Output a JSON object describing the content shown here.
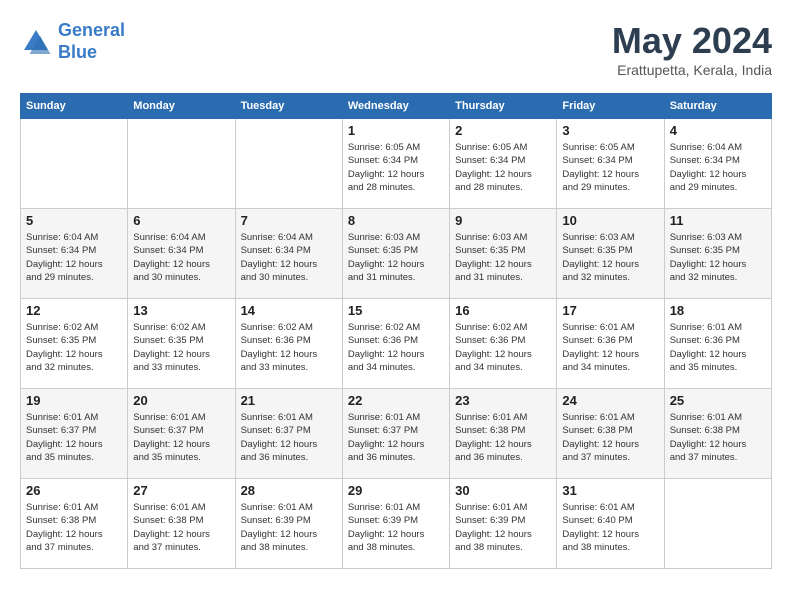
{
  "header": {
    "logo_line1": "General",
    "logo_line2": "Blue",
    "month": "May 2024",
    "location": "Erattupetta, Kerala, India"
  },
  "weekdays": [
    "Sunday",
    "Monday",
    "Tuesday",
    "Wednesday",
    "Thursday",
    "Friday",
    "Saturday"
  ],
  "weeks": [
    [
      {
        "day": "",
        "info": ""
      },
      {
        "day": "",
        "info": ""
      },
      {
        "day": "",
        "info": ""
      },
      {
        "day": "1",
        "info": "Sunrise: 6:05 AM\nSunset: 6:34 PM\nDaylight: 12 hours\nand 28 minutes."
      },
      {
        "day": "2",
        "info": "Sunrise: 6:05 AM\nSunset: 6:34 PM\nDaylight: 12 hours\nand 28 minutes."
      },
      {
        "day": "3",
        "info": "Sunrise: 6:05 AM\nSunset: 6:34 PM\nDaylight: 12 hours\nand 29 minutes."
      },
      {
        "day": "4",
        "info": "Sunrise: 6:04 AM\nSunset: 6:34 PM\nDaylight: 12 hours\nand 29 minutes."
      }
    ],
    [
      {
        "day": "5",
        "info": "Sunrise: 6:04 AM\nSunset: 6:34 PM\nDaylight: 12 hours\nand 29 minutes."
      },
      {
        "day": "6",
        "info": "Sunrise: 6:04 AM\nSunset: 6:34 PM\nDaylight: 12 hours\nand 30 minutes."
      },
      {
        "day": "7",
        "info": "Sunrise: 6:04 AM\nSunset: 6:34 PM\nDaylight: 12 hours\nand 30 minutes."
      },
      {
        "day": "8",
        "info": "Sunrise: 6:03 AM\nSunset: 6:35 PM\nDaylight: 12 hours\nand 31 minutes."
      },
      {
        "day": "9",
        "info": "Sunrise: 6:03 AM\nSunset: 6:35 PM\nDaylight: 12 hours\nand 31 minutes."
      },
      {
        "day": "10",
        "info": "Sunrise: 6:03 AM\nSunset: 6:35 PM\nDaylight: 12 hours\nand 32 minutes."
      },
      {
        "day": "11",
        "info": "Sunrise: 6:03 AM\nSunset: 6:35 PM\nDaylight: 12 hours\nand 32 minutes."
      }
    ],
    [
      {
        "day": "12",
        "info": "Sunrise: 6:02 AM\nSunset: 6:35 PM\nDaylight: 12 hours\nand 32 minutes."
      },
      {
        "day": "13",
        "info": "Sunrise: 6:02 AM\nSunset: 6:35 PM\nDaylight: 12 hours\nand 33 minutes."
      },
      {
        "day": "14",
        "info": "Sunrise: 6:02 AM\nSunset: 6:36 PM\nDaylight: 12 hours\nand 33 minutes."
      },
      {
        "day": "15",
        "info": "Sunrise: 6:02 AM\nSunset: 6:36 PM\nDaylight: 12 hours\nand 34 minutes."
      },
      {
        "day": "16",
        "info": "Sunrise: 6:02 AM\nSunset: 6:36 PM\nDaylight: 12 hours\nand 34 minutes."
      },
      {
        "day": "17",
        "info": "Sunrise: 6:01 AM\nSunset: 6:36 PM\nDaylight: 12 hours\nand 34 minutes."
      },
      {
        "day": "18",
        "info": "Sunrise: 6:01 AM\nSunset: 6:36 PM\nDaylight: 12 hours\nand 35 minutes."
      }
    ],
    [
      {
        "day": "19",
        "info": "Sunrise: 6:01 AM\nSunset: 6:37 PM\nDaylight: 12 hours\nand 35 minutes."
      },
      {
        "day": "20",
        "info": "Sunrise: 6:01 AM\nSunset: 6:37 PM\nDaylight: 12 hours\nand 35 minutes."
      },
      {
        "day": "21",
        "info": "Sunrise: 6:01 AM\nSunset: 6:37 PM\nDaylight: 12 hours\nand 36 minutes."
      },
      {
        "day": "22",
        "info": "Sunrise: 6:01 AM\nSunset: 6:37 PM\nDaylight: 12 hours\nand 36 minutes."
      },
      {
        "day": "23",
        "info": "Sunrise: 6:01 AM\nSunset: 6:38 PM\nDaylight: 12 hours\nand 36 minutes."
      },
      {
        "day": "24",
        "info": "Sunrise: 6:01 AM\nSunset: 6:38 PM\nDaylight: 12 hours\nand 37 minutes."
      },
      {
        "day": "25",
        "info": "Sunrise: 6:01 AM\nSunset: 6:38 PM\nDaylight: 12 hours\nand 37 minutes."
      }
    ],
    [
      {
        "day": "26",
        "info": "Sunrise: 6:01 AM\nSunset: 6:38 PM\nDaylight: 12 hours\nand 37 minutes."
      },
      {
        "day": "27",
        "info": "Sunrise: 6:01 AM\nSunset: 6:38 PM\nDaylight: 12 hours\nand 37 minutes."
      },
      {
        "day": "28",
        "info": "Sunrise: 6:01 AM\nSunset: 6:39 PM\nDaylight: 12 hours\nand 38 minutes."
      },
      {
        "day": "29",
        "info": "Sunrise: 6:01 AM\nSunset: 6:39 PM\nDaylight: 12 hours\nand 38 minutes."
      },
      {
        "day": "30",
        "info": "Sunrise: 6:01 AM\nSunset: 6:39 PM\nDaylight: 12 hours\nand 38 minutes."
      },
      {
        "day": "31",
        "info": "Sunrise: 6:01 AM\nSunset: 6:40 PM\nDaylight: 12 hours\nand 38 minutes."
      },
      {
        "day": "",
        "info": ""
      }
    ]
  ]
}
